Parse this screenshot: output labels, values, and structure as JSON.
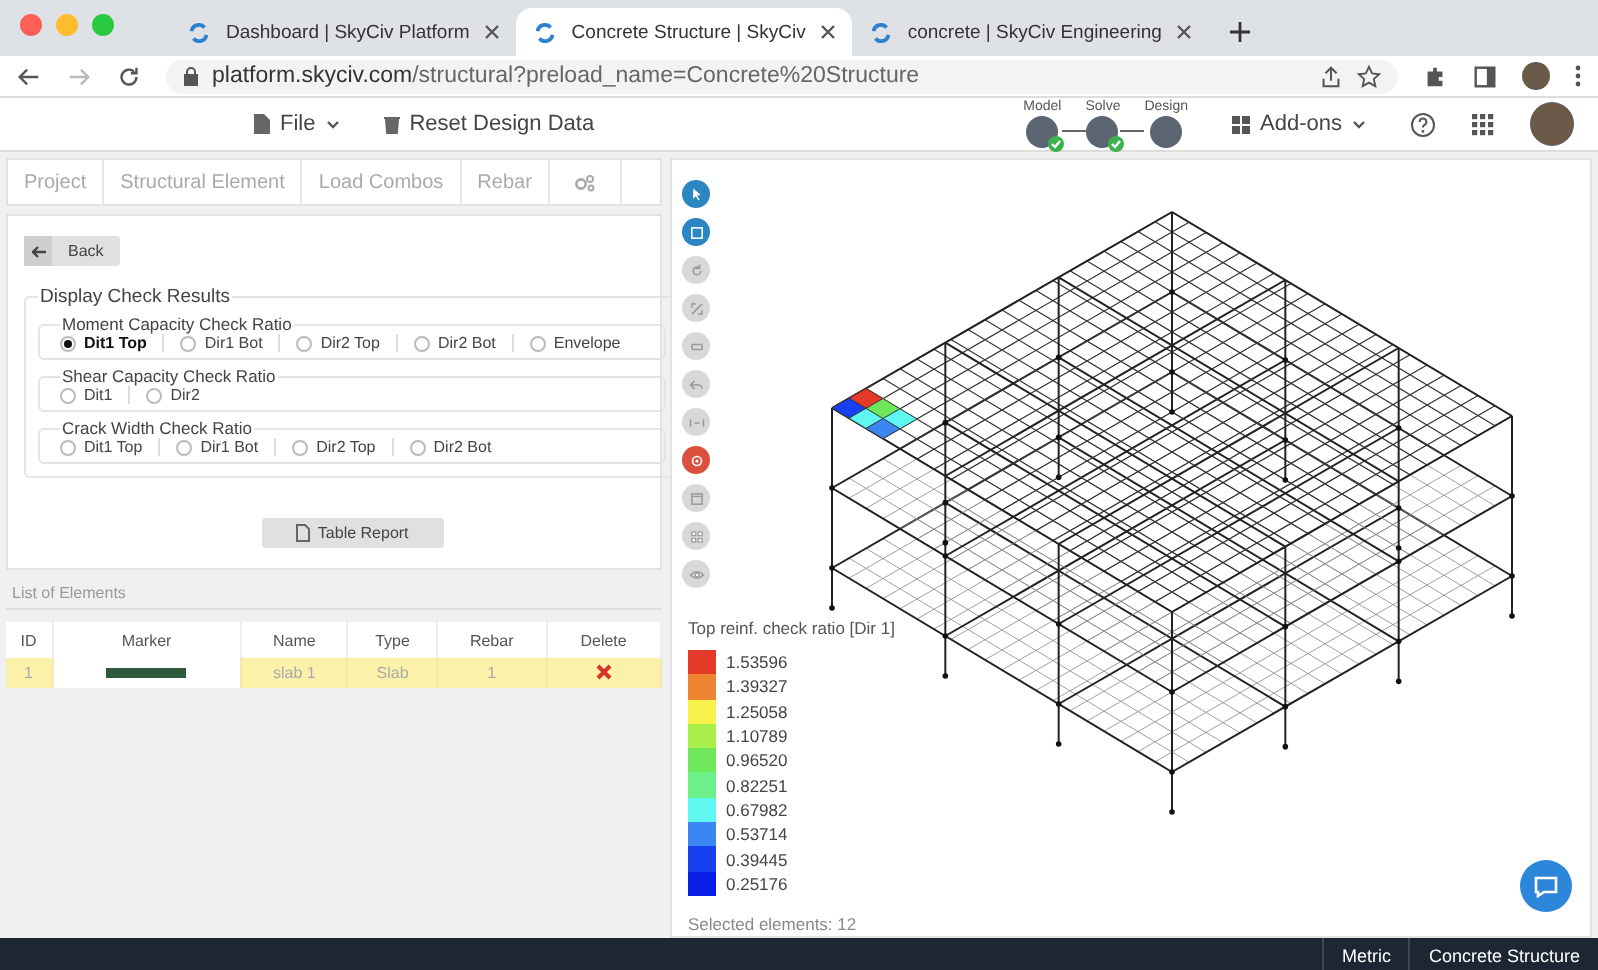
{
  "browser": {
    "tabs": [
      {
        "title": "Dashboard | SkyCiv Platform",
        "selected": false
      },
      {
        "title": "Concrete Structure | SkyCiv",
        "selected": true
      },
      {
        "title": "concrete | SkyCiv Engineering",
        "selected": false
      }
    ],
    "url_host": "platform.skyciv.com",
    "url_path": "/structural?preload_name=Concrete%20Structure"
  },
  "toolbar": {
    "file_menu": "File",
    "reset": "Reset Design Data",
    "steps": [
      {
        "label": "Model",
        "done": true
      },
      {
        "label": "Solve",
        "done": true
      },
      {
        "label": "Design",
        "done": false
      }
    ],
    "addons": "Add-ons"
  },
  "panel_tabs": [
    {
      "label": "Project",
      "selected": false
    },
    {
      "label": "Structural Element",
      "selected": false
    },
    {
      "label": "Load Combos",
      "selected": false
    },
    {
      "label": "Rebar",
      "selected": false
    }
  ],
  "back_button": "Back",
  "check_results": {
    "title": "Display Check Results",
    "groups": [
      {
        "title": "Moment Capacity Check Ratio",
        "options": [
          {
            "label": "Dit1 Top",
            "selected": true
          },
          {
            "label": "Dir1 Bot",
            "selected": false
          },
          {
            "label": "Dir2 Top",
            "selected": false
          },
          {
            "label": "Dir2 Bot",
            "selected": false
          },
          {
            "label": "Envelope",
            "selected": false
          }
        ]
      },
      {
        "title": "Shear Capacity Check Ratio",
        "options": [
          {
            "label": "Dit1",
            "selected": false
          },
          {
            "label": "Dir2",
            "selected": false
          }
        ]
      },
      {
        "title": "Crack Width Check Ratio",
        "options": [
          {
            "label": "Dit1 Top",
            "selected": false
          },
          {
            "label": "Dir1 Bot",
            "selected": false
          },
          {
            "label": "Dir2 Top",
            "selected": false
          },
          {
            "label": "Dir2 Bot",
            "selected": false
          }
        ]
      }
    ]
  },
  "table_report_button": "Table Report",
  "elements": {
    "title": "List of Elements",
    "columns": [
      "ID",
      "Marker",
      "Name",
      "Type",
      "Rebar",
      "Delete"
    ],
    "rows": [
      {
        "id": "1",
        "color": "#2e5a3c",
        "name": "slab 1",
        "type": "Slab",
        "rebar": "1",
        "selected": true
      }
    ]
  },
  "view_tools": [
    {
      "kind": "primary"
    },
    {
      "kind": "primary"
    },
    {
      "kind": "default"
    },
    {
      "kind": "default"
    },
    {
      "kind": "default"
    },
    {
      "kind": "default"
    },
    {
      "kind": "default"
    },
    {
      "kind": "danger"
    },
    {
      "kind": "default"
    },
    {
      "kind": "default"
    },
    {
      "kind": "default"
    }
  ],
  "legend": {
    "title": "Top reinf. check ratio [Dir 1]",
    "entries": [
      {
        "value": "1.53596",
        "color": "#e53a2a"
      },
      {
        "value": "1.39327",
        "color": "#ef8533"
      },
      {
        "value": "1.25058",
        "color": "#f8f24a"
      },
      {
        "value": "1.10789",
        "color": "#a8ef4a"
      },
      {
        "value": "0.96520",
        "color": "#6ee85a"
      },
      {
        "value": "0.82251",
        "color": "#6df08a"
      },
      {
        "value": "0.67982",
        "color": "#5ff7f2"
      },
      {
        "value": "0.53714",
        "color": "#3b86f3"
      },
      {
        "value": "0.39445",
        "color": "#1640f0"
      },
      {
        "value": "0.25176",
        "color": "#0a1ee6"
      }
    ],
    "selected_count": "Selected elements: 12"
  },
  "status_bar": {
    "units": "Metric",
    "module": "Concrete Structure"
  }
}
